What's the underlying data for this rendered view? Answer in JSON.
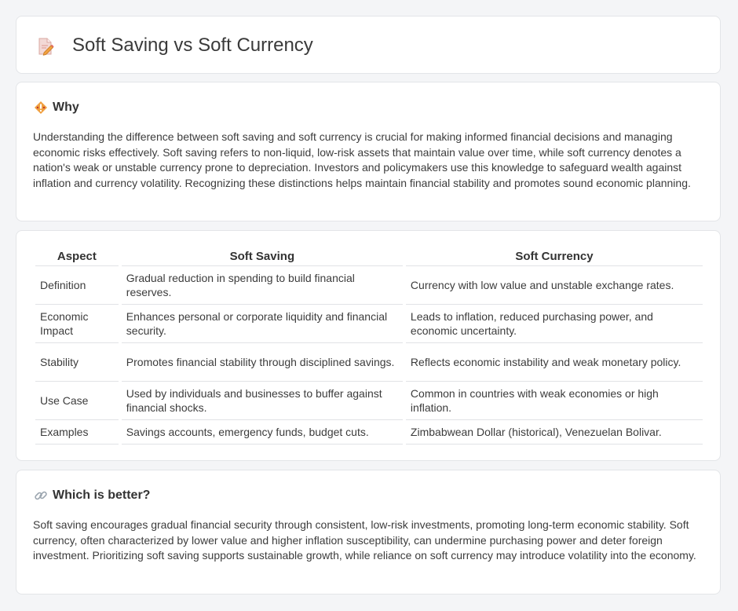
{
  "header": {
    "title": "Soft Saving vs Soft Currency",
    "icon": "document-pencil-icon"
  },
  "why": {
    "icon": "diamond-warning-icon",
    "title": "Why",
    "text": "Understanding the difference between soft saving and soft currency is crucial for making informed financial decisions and managing economic risks effectively. Soft saving refers to non-liquid, low-risk assets that maintain value over time, while soft currency denotes a nation's weak or unstable currency prone to depreciation. Investors and policymakers use this knowledge to safeguard wealth against inflation and currency volatility. Recognizing these distinctions helps maintain financial stability and promotes sound economic planning."
  },
  "comparison": {
    "headers": [
      "Aspect",
      "Soft Saving",
      "Soft Currency"
    ],
    "rows": [
      [
        "Definition",
        "Gradual reduction in spending to build financial reserves.",
        "Currency with low value and unstable exchange rates."
      ],
      [
        "Economic Impact",
        "Enhances personal or corporate liquidity and financial security.",
        "Leads to inflation, reduced purchasing power, and economic uncertainty."
      ],
      [
        "Stability",
        "Promotes financial stability through disciplined savings.",
        "Reflects economic instability and weak monetary policy."
      ],
      [
        "Use Case",
        "Used by individuals and businesses to buffer against financial shocks.",
        "Common in countries with weak economies or high inflation."
      ],
      [
        "Examples",
        "Savings accounts, emergency funds, budget cuts.",
        "Zimbabwean Dollar (historical), Venezuelan Bolivar."
      ]
    ]
  },
  "which": {
    "icon": "link-icon",
    "title": "Which is better?",
    "text": "Soft saving encourages gradual financial security through consistent, low-risk investments, promoting long-term economic stability. Soft currency, often characterized by lower value and higher inflation susceptibility, can undermine purchasing power and deter foreign investment. Prioritizing soft saving supports sustainable growth, while reliance on soft currency may introduce volatility into the economy."
  },
  "colors": {
    "background": "#f4f5f7",
    "card": "#ffffff",
    "border": "#e3e5e8",
    "accent_orange": "#f0a040",
    "icon_pink": "#e56a6a"
  }
}
